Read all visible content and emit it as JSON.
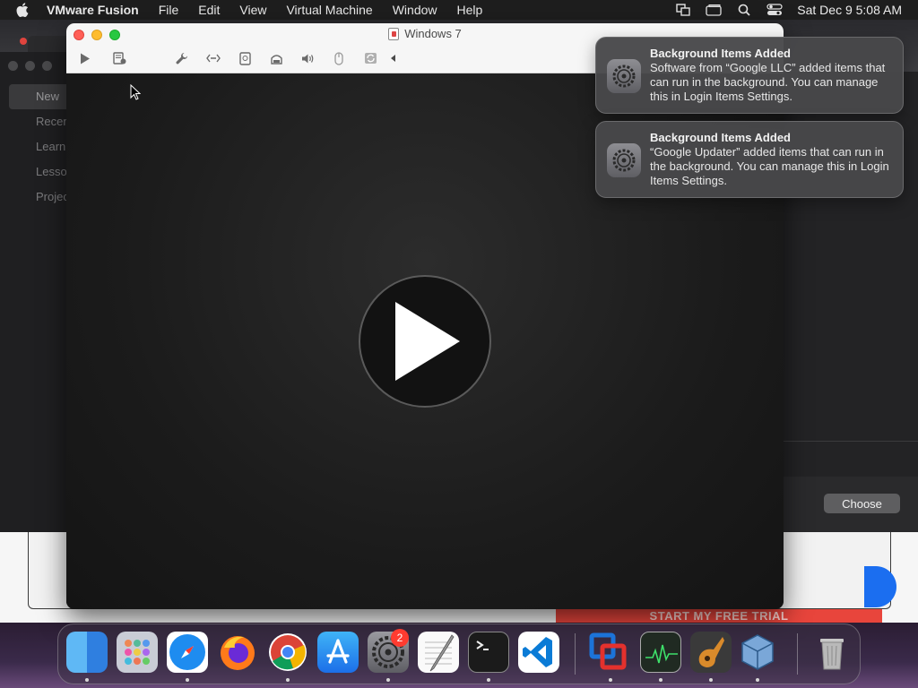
{
  "menubar": {
    "app_name": "VMware Fusion",
    "items": [
      "File",
      "Edit",
      "View",
      "Virtual Machine",
      "Window",
      "Help"
    ],
    "clock": "Sat Dec 9  5:08 AM",
    "status_icons": [
      "screen-mirror-icon",
      "window-icon",
      "search-icon",
      "control-center-icon"
    ]
  },
  "library_sidebar": {
    "items": [
      "New",
      "Recen",
      "Learn",
      "Lesso",
      "Projec"
    ]
  },
  "vm_window": {
    "title": "Windows 7",
    "toolbar_icons": [
      "play-icon",
      "snapshot-icon",
      "settings-wrench-icon",
      "network-icon",
      "hard-disk-icon",
      "printer-icon",
      "sound-icon",
      "usb-icon",
      "sync-icon",
      "collapse-arrow-icon"
    ]
  },
  "dialog": {
    "choose_label": "Choose"
  },
  "banner": {
    "text": "START MY FREE TRIAL"
  },
  "notifications": [
    {
      "title": "Background Items Added",
      "body": "Software from “Google LLC” added items that can run in the background. You can manage this in Login Items Settings."
    },
    {
      "title": "Background Items Added",
      "body": "“Google Updater” added items that can run in the background. You can manage this in Login Items Settings."
    }
  ],
  "dock": {
    "apps": [
      "Finder",
      "Launchpad",
      "Safari",
      "Firefox",
      "Google Chrome",
      "App Store",
      "System Settings",
      "TextEdit",
      "Terminal",
      "Visual Studio Code",
      "VMware Fusion",
      "Activity Monitor",
      "GarageBand",
      "VirtualBox",
      "Trash"
    ],
    "settings_badge": "2"
  },
  "colors": {
    "accent_red": "#ff5f57",
    "accent_yellow": "#febc2e",
    "accent_green": "#28c840",
    "badge_red": "#ff3b30"
  }
}
